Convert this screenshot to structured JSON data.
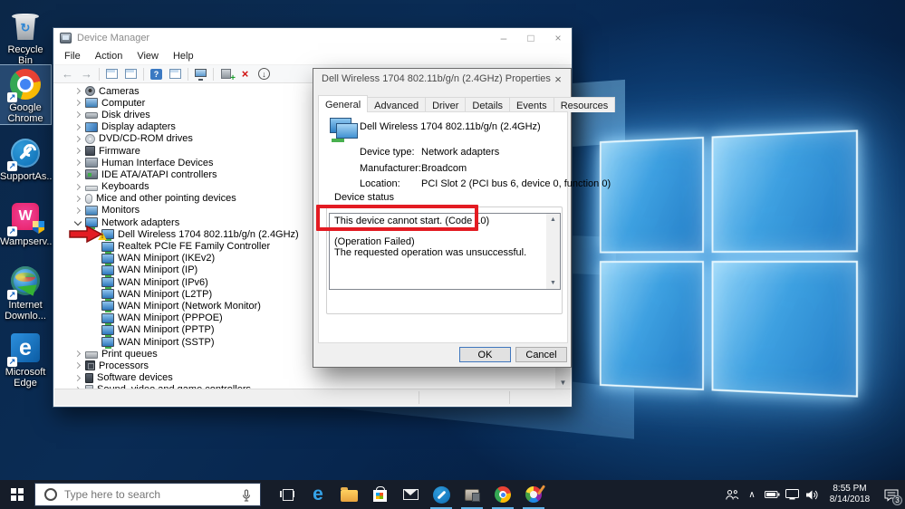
{
  "desktop": {
    "icons": [
      {
        "label": "Recycle Bin"
      },
      {
        "label": "Google Chrome"
      },
      {
        "label": "SupportAs..."
      },
      {
        "label": "Wampserv..."
      },
      {
        "label": "Internet Downlo..."
      },
      {
        "label": "Microsoft Edge"
      }
    ]
  },
  "device_manager": {
    "title": "Device Manager",
    "window_buttons": {
      "minimize": "–",
      "maximize": "□",
      "close": "×"
    },
    "menus": [
      "File",
      "Action",
      "View",
      "Help"
    ],
    "tree": [
      {
        "chev": "col",
        "icon": "i-cam",
        "cls": "lvl0",
        "label": "Cameras"
      },
      {
        "chev": "col",
        "icon": "i-comp",
        "cls": "lvl0",
        "label": "Computer"
      },
      {
        "chev": "col",
        "icon": "i-disk",
        "cls": "lvl0",
        "label": "Disk drives"
      },
      {
        "chev": "col",
        "icon": "i-disp",
        "cls": "lvl0",
        "label": "Display adapters"
      },
      {
        "chev": "col",
        "icon": "i-dvd",
        "cls": "lvl0",
        "label": "DVD/CD-ROM drives"
      },
      {
        "chev": "col",
        "icon": "i-fw",
        "cls": "lvl0",
        "label": "Firmware"
      },
      {
        "chev": "col",
        "icon": "i-hid",
        "cls": "lvl0",
        "label": "Human Interface Devices"
      },
      {
        "chev": "col",
        "icon": "i-ide",
        "cls": "lvl0",
        "label": "IDE ATA/ATAPI controllers"
      },
      {
        "chev": "col",
        "icon": "i-kbd",
        "cls": "lvl0",
        "label": "Keyboards"
      },
      {
        "chev": "col",
        "icon": "i-mouse",
        "cls": "lvl0",
        "label": "Mice and other pointing devices"
      },
      {
        "chev": "col",
        "icon": "i-mon",
        "cls": "lvl0",
        "label": "Monitors"
      },
      {
        "chev": "exp",
        "icon": "i-net",
        "cls": "lvl0",
        "label": "Network adapters"
      },
      {
        "chev": "",
        "icon": "i-net",
        "cls": "lvl1 warn",
        "label": "Dell Wireless 1704 802.11b/g/n (2.4GHz)"
      },
      {
        "chev": "",
        "icon": "i-net",
        "cls": "lvl1",
        "label": "Realtek PCIe FE Family Controller"
      },
      {
        "chev": "",
        "icon": "i-net",
        "cls": "lvl1",
        "label": "WAN Miniport (IKEv2)"
      },
      {
        "chev": "",
        "icon": "i-net",
        "cls": "lvl1",
        "label": "WAN Miniport (IP)"
      },
      {
        "chev": "",
        "icon": "i-net",
        "cls": "lvl1",
        "label": "WAN Miniport (IPv6)"
      },
      {
        "chev": "",
        "icon": "i-net",
        "cls": "lvl1",
        "label": "WAN Miniport (L2TP)"
      },
      {
        "chev": "",
        "icon": "i-net",
        "cls": "lvl1",
        "label": "WAN Miniport (Network Monitor)"
      },
      {
        "chev": "",
        "icon": "i-net",
        "cls": "lvl1",
        "label": "WAN Miniport (PPPOE)"
      },
      {
        "chev": "",
        "icon": "i-net",
        "cls": "lvl1",
        "label": "WAN Miniport (PPTP)"
      },
      {
        "chev": "",
        "icon": "i-net",
        "cls": "lvl1",
        "label": "WAN Miniport (SSTP)"
      },
      {
        "chev": "col",
        "icon": "i-prn",
        "cls": "lvl0",
        "label": "Print queues"
      },
      {
        "chev": "col",
        "icon": "i-cpu",
        "cls": "lvl0",
        "label": "Processors"
      },
      {
        "chev": "col",
        "icon": "i-soft",
        "cls": "lvl0",
        "label": "Software devices"
      },
      {
        "chev": "col",
        "icon": "i-snd",
        "cls": "lvl0",
        "label": "Sound, video and game controllers"
      }
    ]
  },
  "dialog": {
    "title": "Dell Wireless 1704 802.11b/g/n (2.4GHz) Properties",
    "close": "×",
    "tabs": [
      {
        "label": "General",
        "state": "active"
      },
      {
        "label": "Advanced",
        "state": ""
      },
      {
        "label": "Driver",
        "state": ""
      },
      {
        "label": "Details",
        "state": ""
      },
      {
        "label": "Events",
        "state": ""
      },
      {
        "label": "Resources",
        "state": ""
      }
    ],
    "device_name": "Dell Wireless 1704 802.11b/g/n (2.4GHz)",
    "fields": [
      {
        "label": "Device type:",
        "value": "Network adapters"
      },
      {
        "label": "Manufacturer:",
        "value": "Broadcom"
      },
      {
        "label": "Location:",
        "value": "PCI Slot 2 (PCI bus 6, device 0, function 0)"
      }
    ],
    "group_label": "Device status",
    "status": {
      "line1": "This device cannot start. (Code 10)",
      "line2": "(Operation Failed)",
      "line3": "The requested operation was unsuccessful."
    },
    "buttons": {
      "ok": "OK",
      "cancel": "Cancel"
    }
  },
  "annotations": {
    "highlight_color": "#e31b22"
  },
  "taskbar": {
    "search_placeholder": "Type here to search",
    "icons": [
      "task-view",
      "edge",
      "file-explorer",
      "store",
      "mail",
      "supportassist",
      "device-manager",
      "chrome",
      "paint-3d"
    ],
    "running_icons": [
      "supportassist",
      "device-manager",
      "chrome",
      "paint-3d"
    ],
    "tray_icons": [
      "people",
      "chevron-up",
      "battery",
      "network",
      "volume"
    ],
    "clock": {
      "time": "8:55 PM",
      "date": "8/14/2018"
    },
    "notification_badge": "3"
  }
}
